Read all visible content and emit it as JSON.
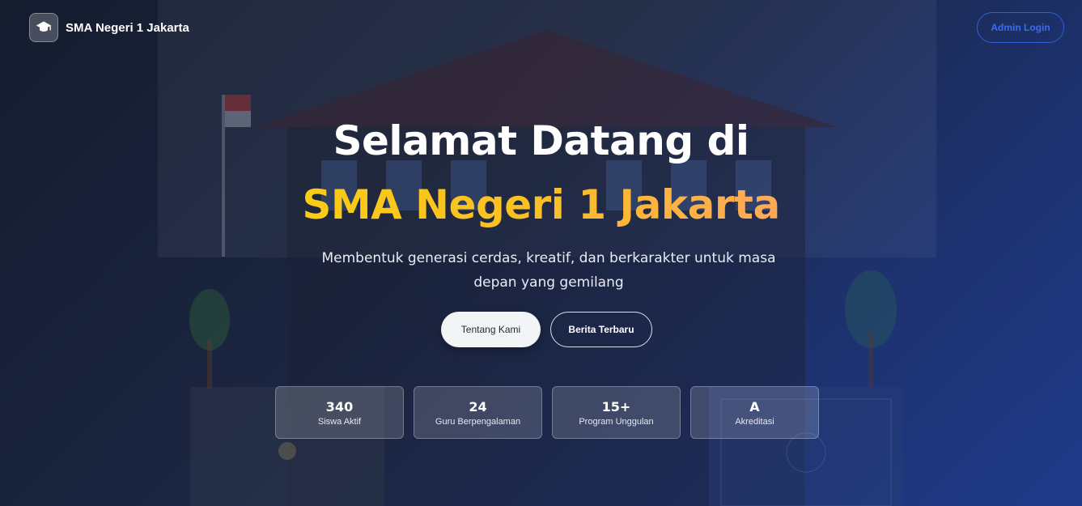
{
  "header": {
    "brand_name": "SMA Negeri 1 Jakarta",
    "brand_icon": "graduation-cap-icon",
    "admin_login_label": "Admin Login"
  },
  "hero": {
    "title_line1": "Selamat Datang di",
    "title_line2": "SMA Negeri 1 Jakarta",
    "subtitle": "Membentuk generasi cerdas, kreatif, dan berkarakter untuk masa depan yang gemilang",
    "buttons": {
      "primary_label": "Tentang Kami",
      "secondary_label": "Berita Terbaru"
    }
  },
  "stats": [
    {
      "value": "340",
      "label": "Siswa Aktif"
    },
    {
      "value": "24",
      "label": "Guru Berpengalaman"
    },
    {
      "value": "15+",
      "label": "Program Unggulan"
    },
    {
      "value": "A",
      "label": "Akreditasi"
    }
  ],
  "colors": {
    "accent_blue": "#3b6cf0",
    "title_gradient_start": "#facc15",
    "title_gradient_end": "#fda85a",
    "background_dark": "#141c2e",
    "background_blue": "#1e3a8a"
  }
}
